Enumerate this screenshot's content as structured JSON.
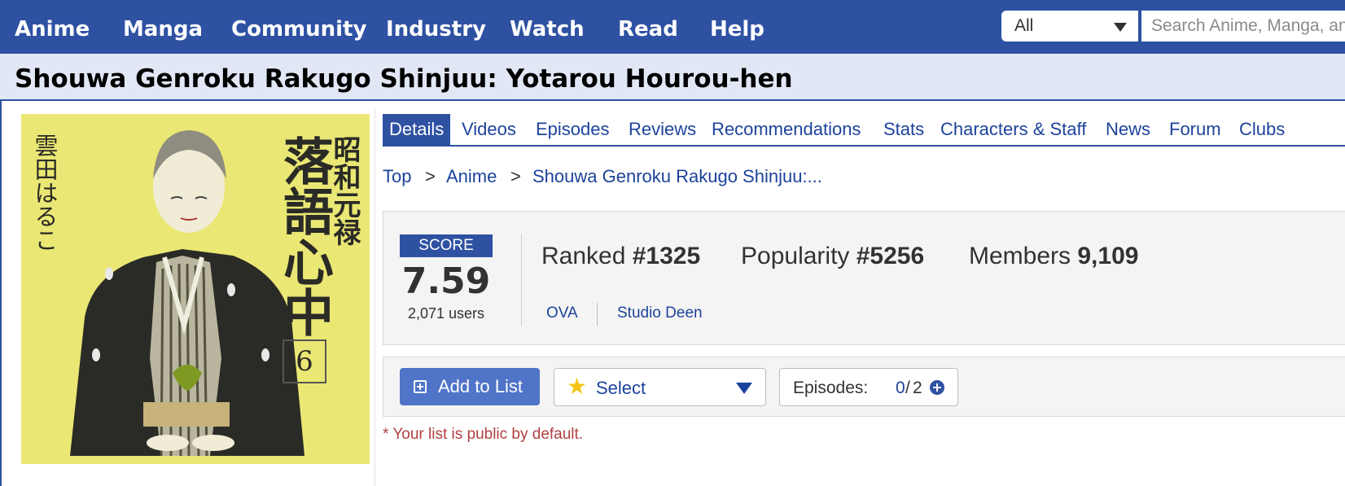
{
  "nav": {
    "items": [
      "Anime",
      "Manga",
      "Community",
      "Industry",
      "Watch",
      "Read",
      "Help"
    ],
    "search_type": "All",
    "search_placeholder": "Search Anime, Manga, and more..."
  },
  "title": "Shouwa Genroku Rakugo Shinjuu: Yotarou Hourou-hen",
  "cover": {
    "author_vertical": "雲田はるこ",
    "series_small": "昭和元禄",
    "series_large": "落語心中",
    "volume": "6"
  },
  "tabs": [
    "Details",
    "Videos",
    "Episodes",
    "Reviews",
    "Recommendations",
    "Stats",
    "Characters & Staff",
    "News",
    "Forum",
    "Clubs"
  ],
  "breadcrumb": {
    "items": [
      "Top",
      "Anime",
      "Shouwa Genroku Rakugo Shinjuu:..."
    ],
    "separator": ">"
  },
  "stats": {
    "score_label": "SCORE",
    "score": "7.59",
    "users": "2,071 users",
    "ranked_label": "Ranked",
    "ranked": "#1325",
    "popularity_label": "Popularity",
    "popularity": "#5256",
    "members_label": "Members",
    "members": "9,109",
    "type": "OVA",
    "studio": "Studio Deen"
  },
  "actions": {
    "add_to_list": "Add to List",
    "select": "Select",
    "episodes_label": "Episodes:",
    "episodes_watched": "0",
    "episodes_separator": "/",
    "episodes_total": "2",
    "public_note": "* Your list is public by default."
  },
  "colors": {
    "brand": "#2e51a2",
    "link": "#1c439b",
    "button": "#4f74c8",
    "note": "#b13f3f",
    "cover_background": "#eae774"
  }
}
